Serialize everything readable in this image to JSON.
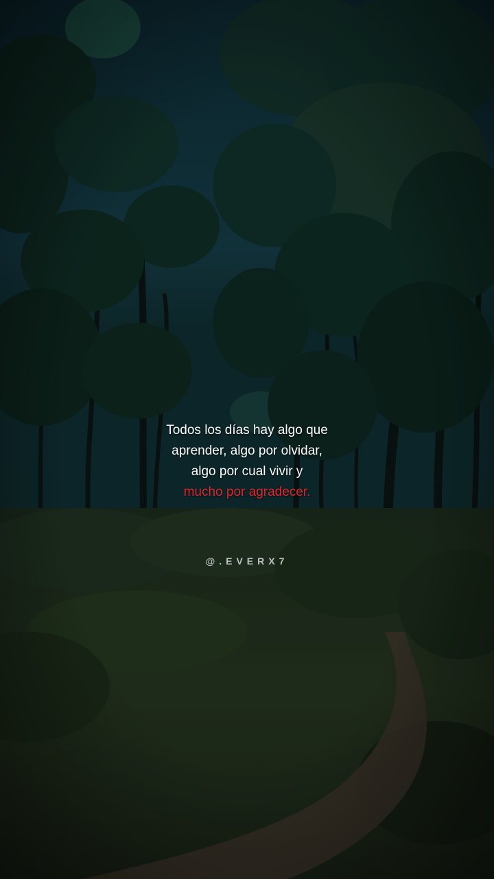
{
  "quote": {
    "lines": [
      "Todos los días hay algo que",
      "aprender, algo por olvidar,",
      "algo por cual vivir y"
    ],
    "highlight": "mucho por agradecer."
  },
  "handle": "@.EVERX7",
  "colors": {
    "text": "#ffffff",
    "highlight": "#e0262a",
    "handle": "#bfbfbf",
    "sky": "#143a44",
    "foliage": "#0f2a22",
    "grass": "#26341f",
    "path": "#3d352c"
  }
}
